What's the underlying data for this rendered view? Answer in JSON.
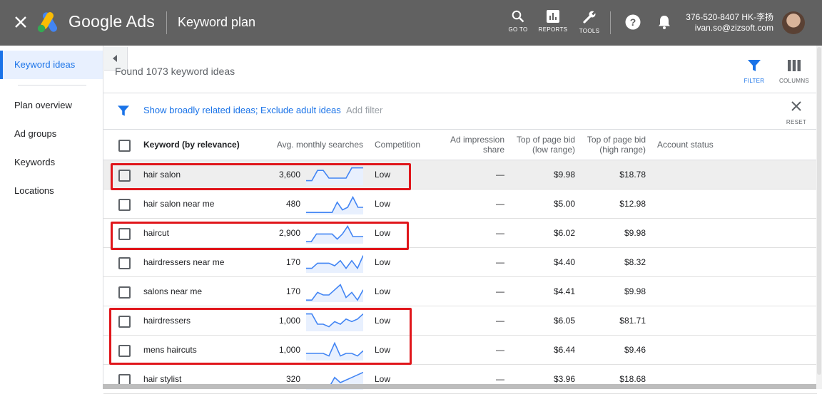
{
  "topbar": {
    "brand": "Google Ads",
    "page_title": "Keyword plan",
    "tools": [
      {
        "label": "GO TO",
        "icon": "search-icon"
      },
      {
        "label": "REPORTS",
        "icon": "reports-icon"
      },
      {
        "label": "TOOLS",
        "icon": "wrench-icon"
      }
    ],
    "account_id": "376-520-8407 HK-李扬",
    "account_email": "ivan.so@zizsoft.com"
  },
  "sidebar": {
    "items": [
      {
        "label": "Keyword ideas",
        "active": true
      },
      {
        "label": "Plan overview"
      },
      {
        "label": "Ad groups"
      },
      {
        "label": "Keywords"
      },
      {
        "label": "Locations"
      }
    ]
  },
  "main": {
    "found_text": "Found 1073 keyword ideas",
    "filter_label": "FILTER",
    "columns_label": "COLUMNS",
    "filter_text": "Show broadly related ideas; Exclude adult ideas",
    "add_filter": "Add filter",
    "reset_label": "RESET"
  },
  "table": {
    "headers": {
      "keyword": "Keyword (by relevance)",
      "searches": "Avg. monthly searches",
      "competition": "Competition",
      "impression_1": "Ad impression",
      "impression_2": "share",
      "low_1": "Top of page bid",
      "low_2": "(low range)",
      "high_1": "Top of page bid",
      "high_2": "(high range)",
      "status": "Account status"
    },
    "rows": [
      {
        "keyword": "hair salon",
        "searches": "3,600",
        "competition": "Low",
        "impression": "—",
        "bid_low": "$9.98",
        "bid_high": "$18.78",
        "trend": [
          6,
          6,
          2,
          2,
          5,
          5,
          5,
          5,
          1,
          1,
          1
        ]
      },
      {
        "keyword": "hair salon near me",
        "searches": "480",
        "competition": "Low",
        "impression": "—",
        "bid_low": "$5.00",
        "bid_high": "$12.98",
        "trend": [
          7,
          7,
          7,
          7,
          7,
          7,
          3,
          6,
          5,
          1,
          5,
          5
        ]
      },
      {
        "keyword": "haircut",
        "searches": "2,900",
        "competition": "Low",
        "impression": "—",
        "bid_low": "$6.02",
        "bid_high": "$9.98",
        "trend": [
          7,
          7,
          4,
          4,
          4,
          4,
          6,
          4,
          1,
          5,
          5,
          5
        ]
      },
      {
        "keyword": "hairdressers near me",
        "searches": "170",
        "competition": "Low",
        "impression": "—",
        "bid_low": "$4.40",
        "bid_high": "$8.32",
        "trend": [
          6,
          6,
          4,
          4,
          4,
          5,
          3,
          6,
          3,
          6,
          1
        ]
      },
      {
        "keyword": "salons near me",
        "searches": "170",
        "competition": "Low",
        "impression": "—",
        "bid_low": "$4.41",
        "bid_high": "$9.98",
        "trend": [
          7,
          7,
          4,
          5,
          5,
          3,
          1,
          6,
          4,
          7,
          3
        ]
      },
      {
        "keyword": "hairdressers",
        "searches": "1,000",
        "competition": "Low",
        "impression": "—",
        "bid_low": "$6.05",
        "bid_high": "$81.71",
        "trend": [
          1,
          1,
          5,
          5,
          6,
          4,
          5,
          3,
          4,
          3,
          1
        ]
      },
      {
        "keyword": "mens haircuts",
        "searches": "1,000",
        "competition": "Low",
        "impression": "—",
        "bid_low": "$6.44",
        "bid_high": "$9.46",
        "trend": [
          5,
          5,
          5,
          5,
          6,
          1,
          6,
          5,
          5,
          6,
          4
        ]
      },
      {
        "keyword": "hair stylist",
        "searches": "320",
        "competition": "Low",
        "impression": "—",
        "bid_low": "$3.96",
        "bid_high": "$18.68",
        "trend": [
          7,
          7,
          7,
          7,
          7,
          3,
          5,
          4,
          3,
          2,
          1
        ]
      }
    ]
  },
  "highlighted_rows": [
    [
      0
    ],
    [
      2
    ],
    [
      5,
      6
    ]
  ],
  "colors": {
    "topbar": "#616161",
    "accent": "#1a73e8",
    "highlight_box": "#e0161b",
    "spark": "#4285f4"
  }
}
